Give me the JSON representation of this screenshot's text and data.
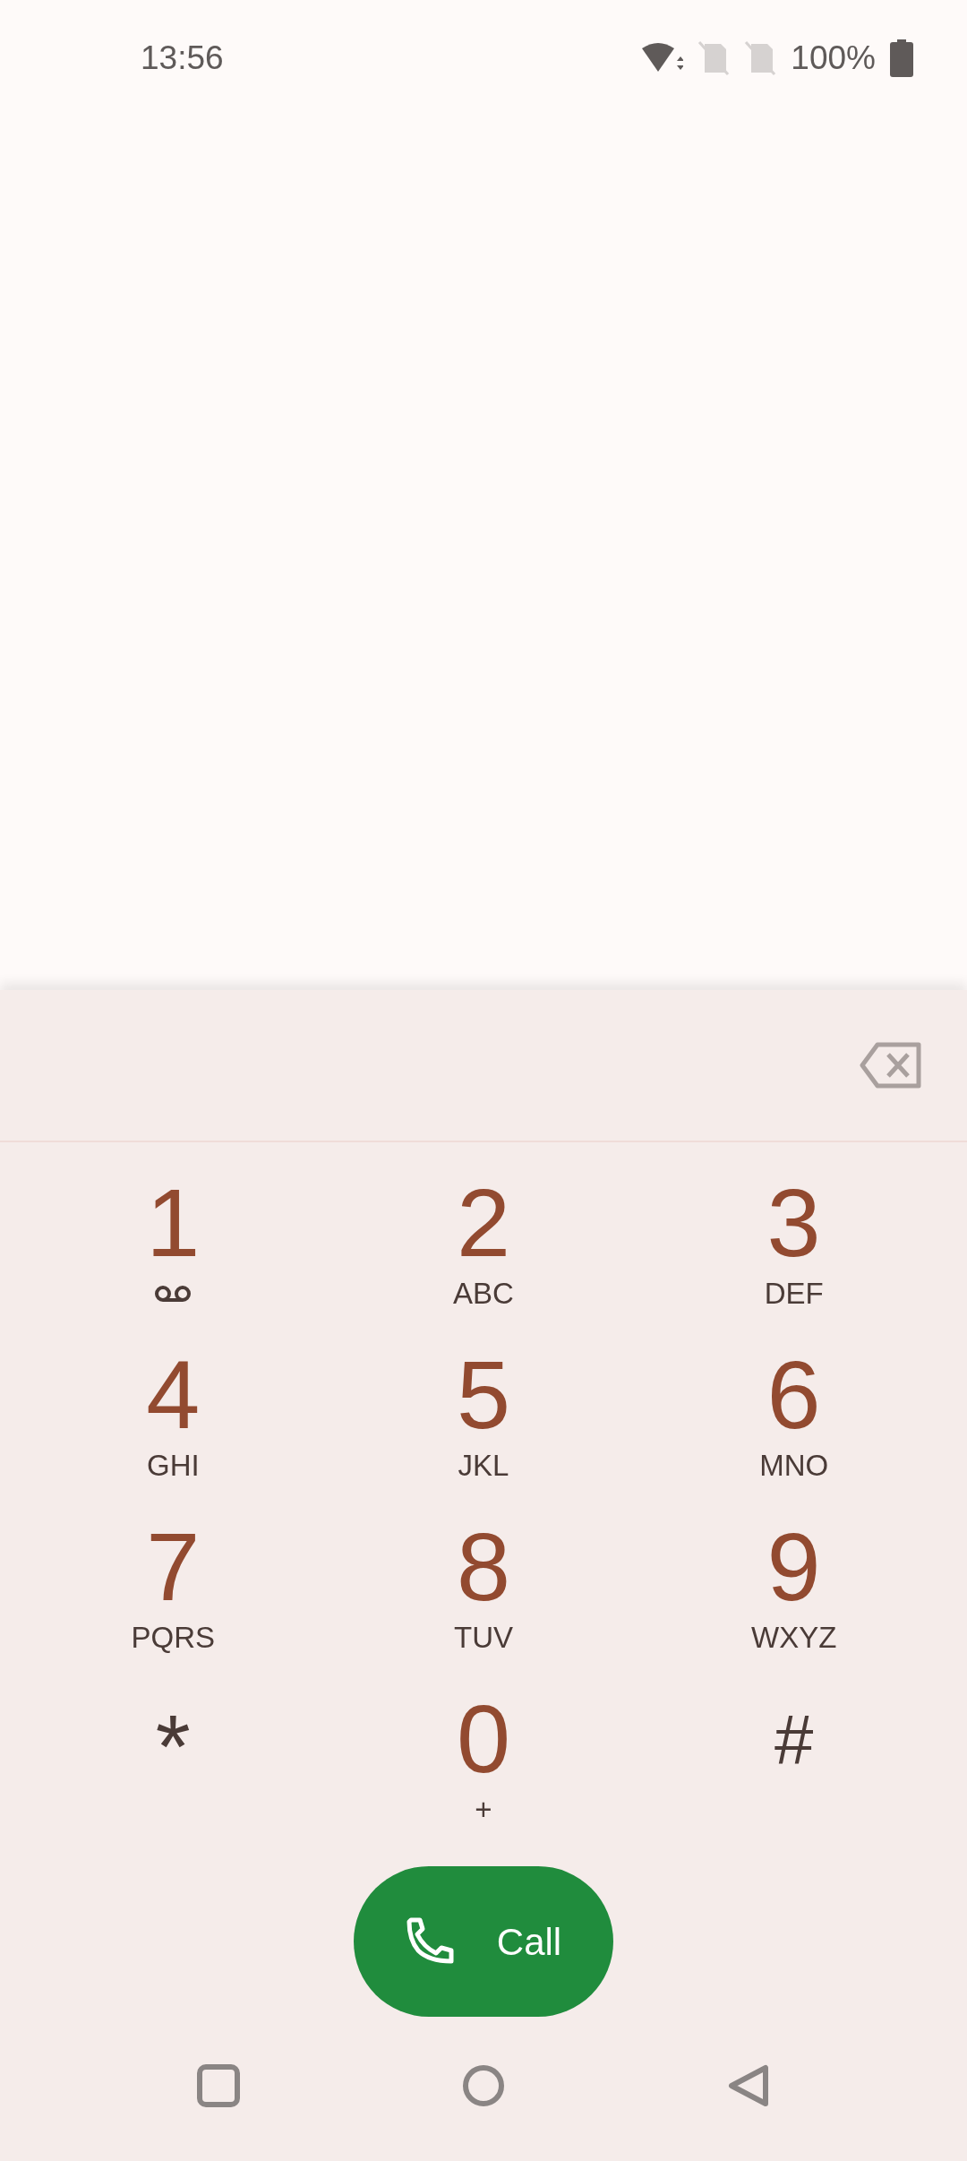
{
  "status_bar": {
    "time": "13:56",
    "battery": "100%"
  },
  "dialpad": {
    "keys": [
      {
        "kind": "voicemail",
        "digit": "1"
      },
      {
        "kind": "digit",
        "digit": "2",
        "letters": "ABC"
      },
      {
        "kind": "digit",
        "digit": "3",
        "letters": "DEF"
      },
      {
        "kind": "digit",
        "digit": "4",
        "letters": "GHI"
      },
      {
        "kind": "digit",
        "digit": "5",
        "letters": "JKL"
      },
      {
        "kind": "digit",
        "digit": "6",
        "letters": "MNO"
      },
      {
        "kind": "digit",
        "digit": "7",
        "letters": "PQRS"
      },
      {
        "kind": "digit",
        "digit": "8",
        "letters": "TUV"
      },
      {
        "kind": "digit",
        "digit": "9",
        "letters": "WXYZ"
      },
      {
        "kind": "symbol",
        "digit": "*"
      },
      {
        "kind": "digit",
        "digit": "0",
        "letters": "+"
      },
      {
        "kind": "symbol",
        "digit": "#"
      }
    ]
  },
  "call_button": {
    "label": "Call"
  }
}
